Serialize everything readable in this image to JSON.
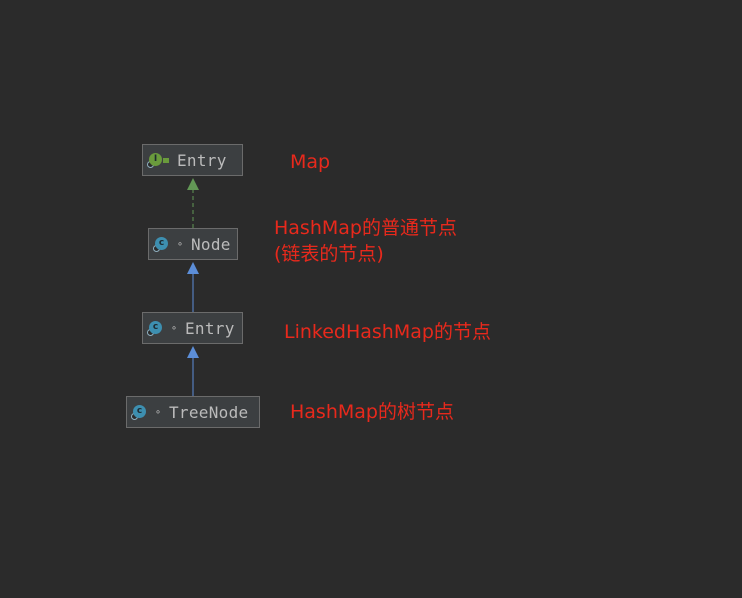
{
  "diagram": {
    "nodes": [
      {
        "id": "map-entry",
        "label": "Entry",
        "kind": "interface",
        "kind_letter": "I",
        "visibility": ""
      },
      {
        "id": "node",
        "label": "Node",
        "kind": "class",
        "kind_letter": "c",
        "visibility": "∘"
      },
      {
        "id": "linked-entry",
        "label": "Entry",
        "kind": "class",
        "kind_letter": "c",
        "visibility": "∘"
      },
      {
        "id": "tree-node",
        "label": "TreeNode",
        "kind": "class",
        "kind_letter": "c",
        "visibility": "∘"
      }
    ],
    "edges": [
      {
        "from": "node",
        "to": "map-entry",
        "type": "implements",
        "style": "dashed",
        "color": "#629755"
      },
      {
        "from": "linked-entry",
        "to": "node",
        "type": "extends",
        "style": "solid",
        "color": "#5c8ed8"
      },
      {
        "from": "tree-node",
        "to": "linked-entry",
        "type": "extends",
        "style": "solid",
        "color": "#5c8ed8"
      }
    ],
    "annotations": {
      "map_entry": "Map",
      "node_line1": "HashMap的普通节点",
      "node_line2": "(链表的节点)",
      "linked_entry": "LinkedHashMap的节点",
      "tree_node": "HashMap的树节点"
    },
    "colors": {
      "background": "#2b2b2b",
      "node_fill": "#3c3f41",
      "node_border": "#6b6b6b",
      "node_text": "#bbbbbb",
      "annotation": "#e8291c"
    }
  }
}
